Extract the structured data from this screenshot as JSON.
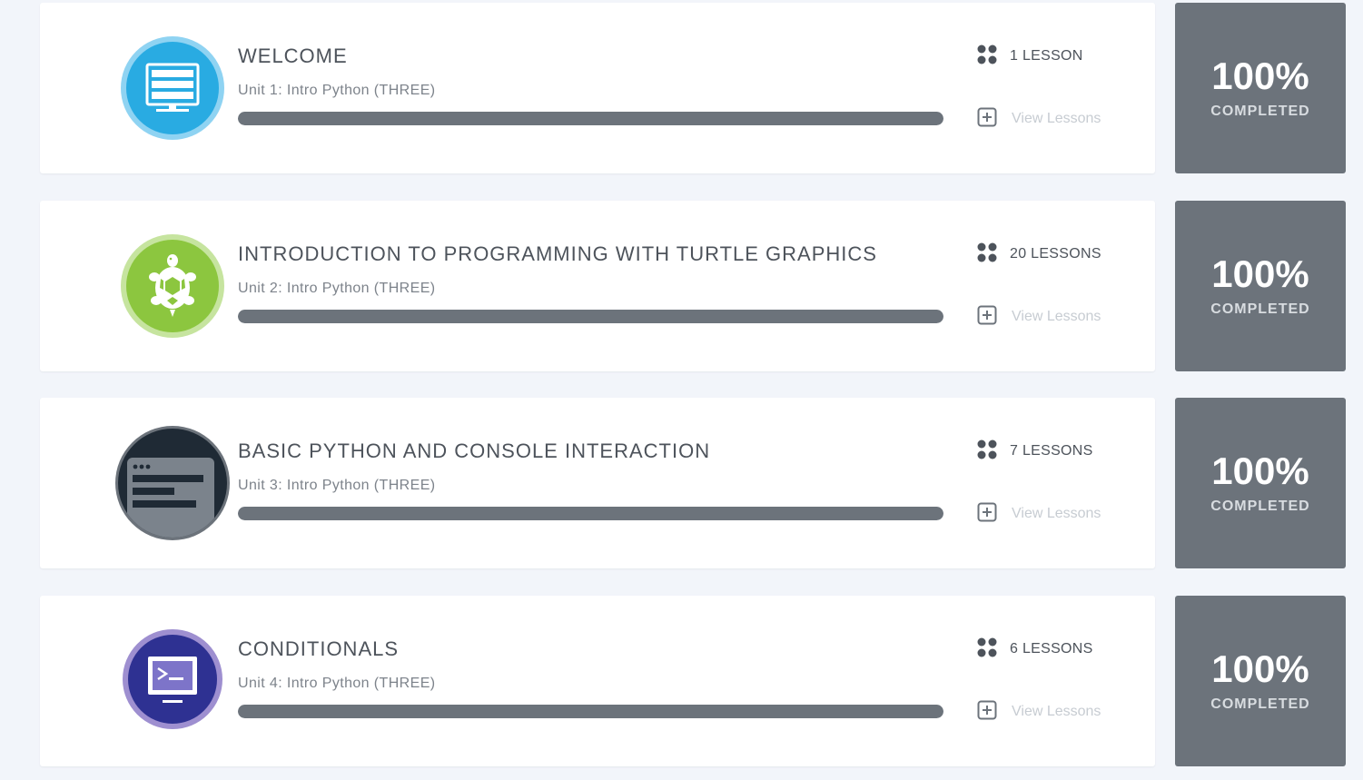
{
  "units": [
    {
      "title": "WELCOME",
      "subtitle": "Unit 1: Intro Python (THREE)",
      "lessons": "1 LESSON",
      "view_label": "View Lessons",
      "progress": 1.0,
      "percent": "100%",
      "status": "COMPLETED",
      "icon": "monitor-icon",
      "icon_color": "#29abe2"
    },
    {
      "title": "INTRODUCTION TO PROGRAMMING WITH TURTLE GRAPHICS",
      "subtitle": "Unit 2: Intro Python (THREE)",
      "lessons": "20 LESSONS",
      "view_label": "View Lessons",
      "progress": 1.0,
      "percent": "100%",
      "status": "COMPLETED",
      "icon": "turtle-icon",
      "icon_color": "#8cc63f"
    },
    {
      "title": "BASIC PYTHON AND CONSOLE INTERACTION",
      "subtitle": "Unit 3: Intro Python (THREE)",
      "lessons": "7 LESSONS",
      "view_label": "View Lessons",
      "progress": 1.0,
      "percent": "100%",
      "status": "COMPLETED",
      "icon": "console-window-icon",
      "icon_color": "#1f2a35"
    },
    {
      "title": "CONDITIONALS",
      "subtitle": "Unit 4: Intro Python (THREE)",
      "lessons": "6 LESSONS",
      "view_label": "View Lessons",
      "progress": 1.0,
      "percent": "100%",
      "status": "COMPLETED",
      "icon": "terminal-prompt-icon",
      "icon_color": "#2e3192"
    }
  ],
  "colors": {
    "background": "#f2f5fa",
    "progress_fill": "#6c737b",
    "status_box": "#6c737b"
  }
}
